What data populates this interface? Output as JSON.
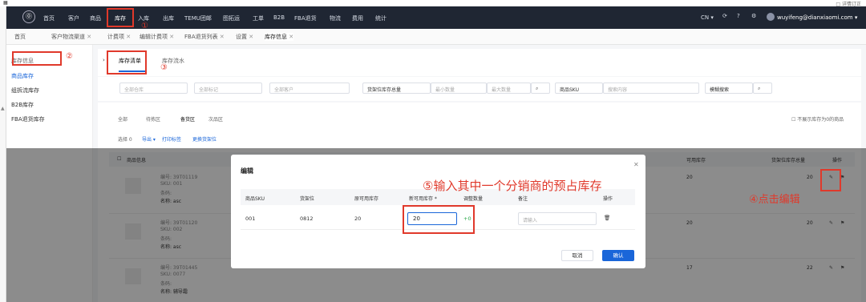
{
  "top": {
    "right_text": "□ 详情订正"
  },
  "nav": {
    "logo": "⓪",
    "items": [
      "首页",
      "客户",
      "商品",
      "库存",
      "入库",
      "出库",
      "TEMU团邮",
      "图拓运",
      "工单",
      "B2B",
      "FBA退货",
      "物流",
      "费用",
      "统计"
    ],
    "region": "CN ▾",
    "user": "wuyifeng@dianxiaomi.com ▾"
  },
  "tabs": [
    "首页",
    "客户物流渠道",
    "计费项",
    "编辑计费项",
    "FBA退货列表",
    "设置",
    "库存信息"
  ],
  "sidebar": {
    "header": "库存信息",
    "items": [
      "商品库存",
      "组拆流库存",
      "B2B库存",
      "FBA退货库存"
    ]
  },
  "subtabs": [
    "库存清单",
    "库存流水"
  ],
  "filters": {
    "warehouse": "全部仓库",
    "mark": "全部标记",
    "customer": "全部客户",
    "sort": "货架位库存总量",
    "min": "最小数量",
    "max": "最大数量",
    "sku": "商品SKU",
    "search": "搜索内容",
    "mode": "模糊搜索"
  },
  "zones": [
    "全部",
    "待拣区",
    "备货区",
    "次品区"
  ],
  "zone_hide": "不展示库存为0的商品",
  "actions": {
    "selected": "选择 0",
    "export": "导出 ▾",
    "print": "打印标签",
    "move": "更换货架位"
  },
  "table": {
    "h1": "商品信息",
    "h2": "可用库存",
    "h3": "货架位库存总量",
    "h4": "操作",
    "rows": [
      {
        "code": "编号: 39T01119",
        "sku": "SKU: 001",
        "cond": "条码:",
        "name": "名称: asc",
        "avail": "20",
        "total": "20"
      },
      {
        "code": "编号: 39T01120",
        "sku": "SKU: 002",
        "cond": "条码:",
        "name": "名称: asc",
        "avail": "20",
        "total": "20"
      },
      {
        "code": "编号: 39T01445",
        "sku": "SKU: 0077",
        "cond": "条码:",
        "name": "名称: 辅导霜",
        "avail": "17",
        "total": "22"
      }
    ]
  },
  "modal": {
    "title": "编辑",
    "cols": [
      "商品SKU",
      "货架位",
      "原可用库存",
      "新可用库存 *",
      "调整数量",
      "备注",
      "操作"
    ],
    "row": {
      "sku": "001",
      "shelf": "0812",
      "old": "20",
      "new": "20",
      "adjust": "+0",
      "note_ph": "请输入"
    },
    "cancel": "取消",
    "ok": "确认"
  },
  "annotations": {
    "a1": "①",
    "a2": "②",
    "a3": "③",
    "a4": "④点击编辑",
    "a5": "⑤输入其中一个分销商的预占库存"
  },
  "colors": {
    "nav": "#1f2633",
    "accent": "#1a66d9",
    "red": "#e0392b"
  }
}
